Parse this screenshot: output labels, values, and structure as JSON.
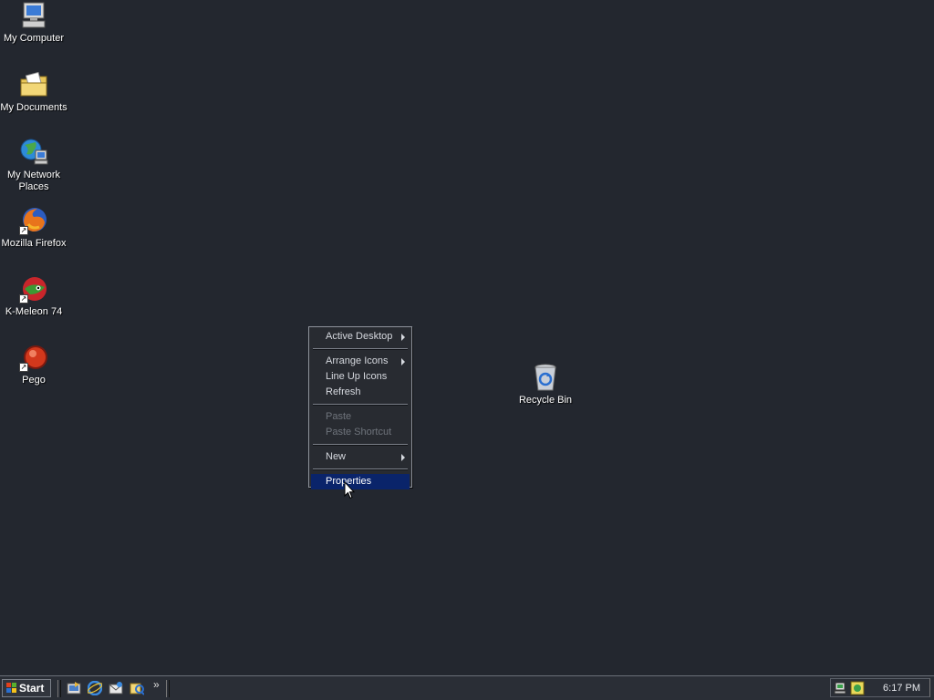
{
  "desktop": {
    "icons": [
      {
        "label": "My Computer",
        "icon": "my-computer-icon"
      },
      {
        "label": "My Documents",
        "icon": "my-documents-icon"
      },
      {
        "label": "My Network Places",
        "icon": "network-places-icon"
      },
      {
        "label": "Mozilla Firefox",
        "icon": "firefox-icon"
      },
      {
        "label": "K-Meleon 74",
        "icon": "kmeleon-icon"
      },
      {
        "label": "Pego",
        "icon": "pego-icon"
      },
      {
        "label": "Recycle Bin",
        "icon": "recycle-bin-icon"
      }
    ]
  },
  "context_menu": {
    "items": [
      {
        "label": "Active Desktop",
        "submenu": true,
        "enabled": true
      },
      {
        "label": "Arrange Icons",
        "submenu": true,
        "enabled": true
      },
      {
        "label": "Line Up Icons",
        "submenu": false,
        "enabled": true
      },
      {
        "label": "Refresh",
        "submenu": false,
        "enabled": true
      },
      {
        "label": "Paste",
        "submenu": false,
        "enabled": false
      },
      {
        "label": "Paste Shortcut",
        "submenu": false,
        "enabled": false
      },
      {
        "label": "New",
        "submenu": true,
        "enabled": true
      },
      {
        "label": "Properties",
        "submenu": false,
        "enabled": true,
        "highlighted": true
      }
    ]
  },
  "taskbar": {
    "start_label": "Start",
    "quick_launch": [
      "show-desktop-icon",
      "internet-explorer-icon",
      "outlook-express-icon",
      "media-icon"
    ],
    "overflow": "»",
    "clock": "6:17 PM",
    "tray_icons": [
      "network-tray-icon",
      "speaker-tray-icon"
    ]
  },
  "colors": {
    "desktop": "#23272f",
    "menu_highlight": "#0a246a"
  }
}
